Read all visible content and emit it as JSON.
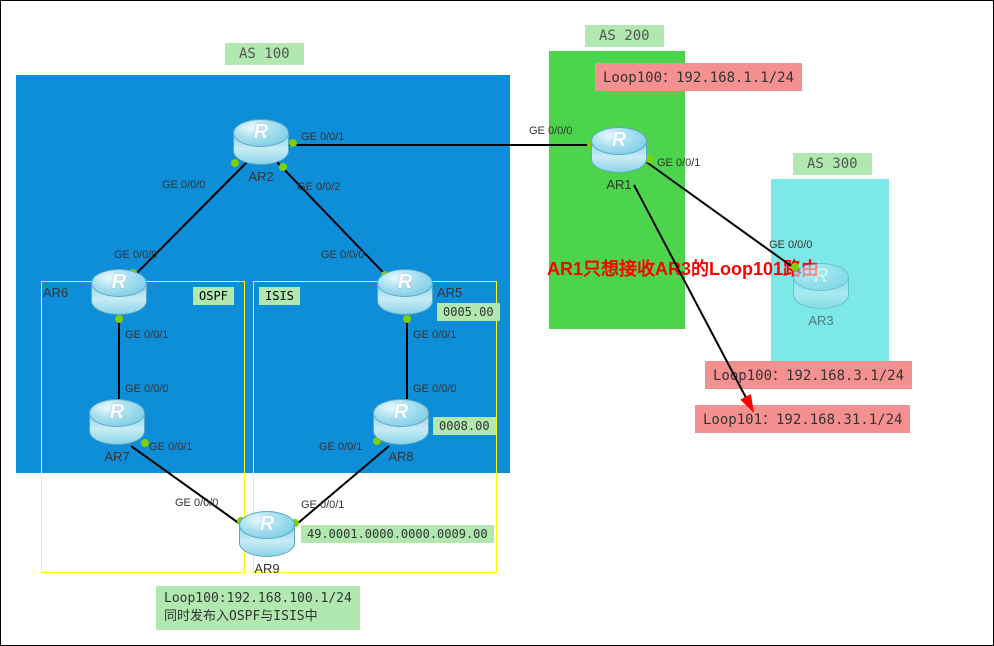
{
  "as": {
    "a100": "AS 100",
    "a200": "AS 200",
    "a300": "AS 300"
  },
  "protocol": {
    "ospf": "OSPF",
    "isis": "ISIS"
  },
  "routers": {
    "ar1": "AR1",
    "ar2": "AR2",
    "ar3": "AR3",
    "ar5": "AR5",
    "ar6": "AR6",
    "ar7": "AR7",
    "ar8": "AR8",
    "ar9": "AR9"
  },
  "isis_ids": {
    "ar5": "0005.00",
    "ar8": "0008.00",
    "ar9": "49.0001.0000.0000.0009.00"
  },
  "loops": {
    "ar1_loop100": "Loop100：192.168.1.1/24",
    "ar3_loop100": "Loop100：192.168.3.1/24",
    "ar3_loop101": "Loop101：192.168.31.1/24"
  },
  "note": {
    "red": "AR1只想接收AR3的Loop101路由",
    "ar9_line1": "Loop100:192.168.100.1/24",
    "ar9_line2": "同时发布入OSPF与ISIS中"
  },
  "ports": {
    "ar2_ge000": "GE 0/0/0",
    "ar2_ge001": "GE 0/0/1",
    "ar2_ge002": "GE 0/0/2",
    "ar6_ge000": "GE 0/0/0",
    "ar6_ge001": "GE 0/0/1",
    "ar7_ge000": "GE 0/0/0",
    "ar7_ge001": "GE 0/0/1",
    "ar5_ge000": "GE 0/0/0",
    "ar5_ge001": "GE 0/0/1",
    "ar8_ge000": "GE 0/0/0",
    "ar8_ge001": "GE 0/0/1",
    "ar9_ge000": "GE 0/0/0",
    "ar9_ge001": "GE 0/0/1",
    "ar1_ge000": "GE 0/0/0",
    "ar1_ge001": "GE 0/0/1",
    "ar3_ge000": "GE 0/0/0"
  },
  "chart_data": {
    "type": "network-topology",
    "as": [
      {
        "name": "AS 100",
        "routers": [
          "AR2",
          "AR5",
          "AR6",
          "AR7",
          "AR8",
          "AR9"
        ],
        "protocols": {
          "OSPF": [
            "AR6",
            "AR7",
            "AR9"
          ],
          "ISIS": [
            "AR5",
            "AR8",
            "AR9"
          ]
        }
      },
      {
        "name": "AS 200",
        "routers": [
          "AR1"
        ]
      },
      {
        "name": "AS 300",
        "routers": [
          "AR3"
        ]
      }
    ],
    "links": [
      {
        "a": "AR2",
        "a_if": "GE 0/0/1",
        "b": "AR1",
        "b_if": "GE 0/0/0"
      },
      {
        "a": "AR2",
        "a_if": "GE 0/0/0",
        "b": "AR6",
        "b_if": "GE 0/0/0"
      },
      {
        "a": "AR2",
        "a_if": "GE 0/0/2",
        "b": "AR5",
        "b_if": "GE 0/0/0"
      },
      {
        "a": "AR6",
        "a_if": "GE 0/0/1",
        "b": "AR7",
        "b_if": "GE 0/0/0"
      },
      {
        "a": "AR7",
        "a_if": "GE 0/0/1",
        "b": "AR9",
        "b_if": "GE 0/0/0"
      },
      {
        "a": "AR5",
        "a_if": "GE 0/0/1",
        "b": "AR8",
        "b_if": "GE 0/0/0"
      },
      {
        "a": "AR8",
        "a_if": "GE 0/0/1",
        "b": "AR9",
        "b_if": "GE 0/0/1"
      },
      {
        "a": "AR1",
        "a_if": "GE 0/0/1",
        "b": "AR3",
        "b_if": "GE 0/0/0"
      }
    ],
    "isis_net_ids": {
      "AR5": "0005.00",
      "AR8": "0008.00",
      "AR9": "49.0001.0000.0000.0009.00"
    },
    "loopbacks": {
      "AR1": [
        {
          "name": "Loop100",
          "ip": "192.168.1.1/24"
        }
      ],
      "AR3": [
        {
          "name": "Loop100",
          "ip": "192.168.3.1/24"
        },
        {
          "name": "Loop101",
          "ip": "192.168.31.1/24"
        }
      ],
      "AR9": [
        {
          "name": "Loop100",
          "ip": "192.168.100.1/24",
          "note": "redistributed into OSPF and ISIS"
        }
      ]
    },
    "annotation": "AR1只想接收AR3的Loop101路由"
  }
}
